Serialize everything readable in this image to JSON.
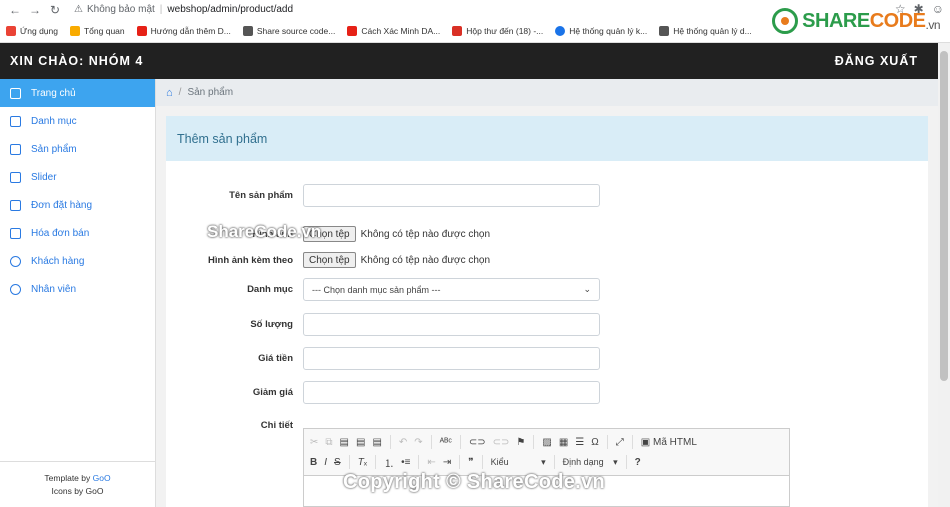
{
  "browser": {
    "security_label": "Không bảo mật",
    "url": "webshop/admin/product/add",
    "bookmarks": [
      {
        "label": "Ứng dụng",
        "color": "#ea4335"
      },
      {
        "label": "Tổng quan",
        "color": "#f9ab00"
      },
      {
        "label": "Hướng dẫn thêm D...",
        "color": "#e62117"
      },
      {
        "label": "Share source code...",
        "color": "#555555"
      },
      {
        "label": "Cách Xác Minh DA...",
        "color": "#e62117"
      },
      {
        "label": "Hộp thư đến (18) -...",
        "color": "#d93025"
      },
      {
        "label": "Hệ thống quản lý k...",
        "color": "#1a73e8"
      },
      {
        "label": "Hệ thống quản lý d...",
        "color": "#555555"
      }
    ]
  },
  "brand": {
    "part1": "SHARE",
    "part2": "CODE",
    ".vn": ".vn",
    "vn": ".vn"
  },
  "topbar": {
    "greeting": "XIN CHÀO: NHÓM 4",
    "logout": "ĐĂNG XUẤT"
  },
  "sidebar": {
    "items": [
      {
        "label": "Trang chủ"
      },
      {
        "label": "Danh mục"
      },
      {
        "label": "Sản phẩm"
      },
      {
        "label": "Slider"
      },
      {
        "label": "Đơn đặt hàng"
      },
      {
        "label": "Hóa đơn bán"
      },
      {
        "label": "Khách hàng"
      },
      {
        "label": "Nhân viên"
      }
    ],
    "footer_template": "Template by ",
    "footer_template_link": "GoO",
    "footer_icons": "Icons by GoO"
  },
  "breadcrumb": {
    "current": "Sản phẩm"
  },
  "panel": {
    "title": "Thêm sản phẩm"
  },
  "form": {
    "name_label": "Tên sản phẩm",
    "image_label": "Hình ảnh",
    "extra_image_label": "Hình ảnh kèm theo",
    "file_button": "Chọn tệp",
    "file_status": "Không có tệp nào được chọn",
    "category_label": "Danh mục",
    "category_placeholder": "--- Chọn danh mục sản phẩm ---",
    "qty_label": "Số lượng",
    "price_label": "Giá tiền",
    "discount_label": "Giảm giá",
    "detail_label": "Chi tiết"
  },
  "editor": {
    "source_label": "Mã HTML",
    "style_label": "Kiểu",
    "format_label": "Định dạng"
  },
  "watermarks": {
    "center": "Copyright © ShareCode.vn",
    "mid": "ShareCode.vn"
  }
}
